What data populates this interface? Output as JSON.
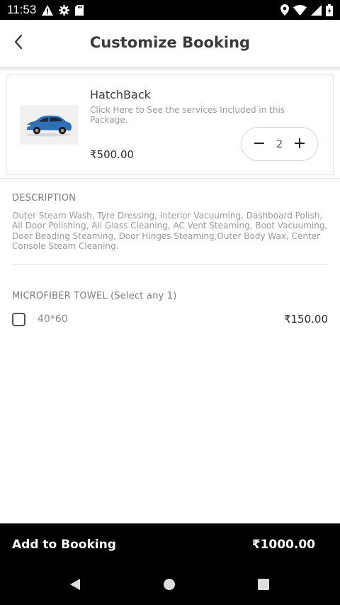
{
  "status_bar": {
    "time": "11:53",
    "left_icons": [
      "warning-icon",
      "gear-icon",
      "sd-card-icon"
    ],
    "right_icons": [
      "location-icon",
      "wifi-icon",
      "signal-icon",
      "battery-icon"
    ]
  },
  "header": {
    "title": "Customize Booking",
    "back_icon": "chevron-left-icon"
  },
  "package": {
    "name": "HatchBack",
    "description": "Click Here to See the services Included in this Package.",
    "price": "₹500.00",
    "quantity": "2",
    "car_color": "#2f6fb5"
  },
  "description": {
    "label": "DESCRIPTION",
    "text": "Outer Steam Wash, Tyre Dressing, Interior Vacuuming, Dashboard Polish, All Door Polishing, All Glass Cleaning, AC Vent Steaming, Boot Vacuuming, Door Beading Steaming, Door Hinges Steaming,Outer Body Wax, Center Console Steam Cleaning."
  },
  "addon": {
    "label": "MICROFIBER TOWEL (Select any  1)",
    "options": [
      {
        "name": "40*60",
        "price": "₹150.00",
        "checked": false
      }
    ]
  },
  "booking_bar": {
    "label": "Add to Booking",
    "total": "₹1000.00"
  },
  "nav": [
    "back-icon",
    "home-icon",
    "recents-icon"
  ]
}
